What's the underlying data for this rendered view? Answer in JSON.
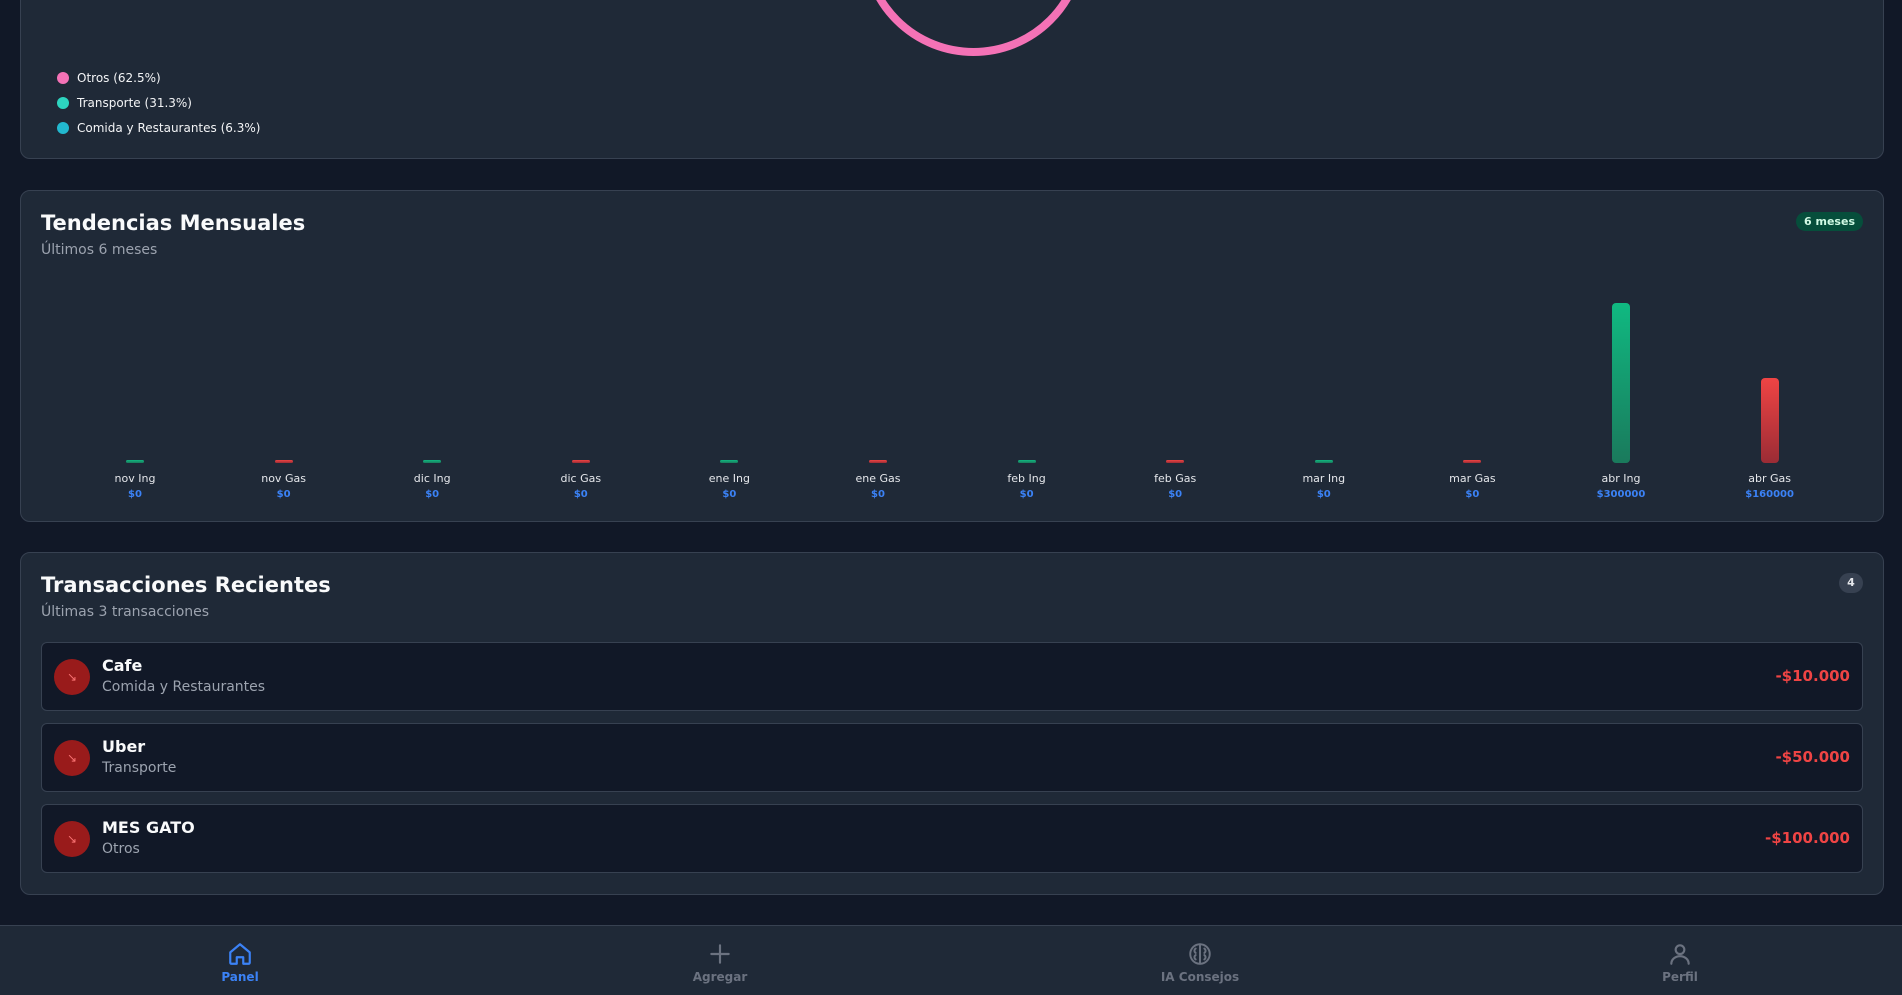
{
  "breakdown": {
    "legend": [
      {
        "label": "Otros (62.5%)",
        "color": "#f472b6"
      },
      {
        "label": "Transporte (31.3%)",
        "color": "#2dd4bf"
      },
      {
        "label": "Comida y Restaurantes (6.3%)",
        "color": "#22b8cf"
      }
    ]
  },
  "trends": {
    "title": "Tendencias Mensuales",
    "subtitle": "Últimos 6 meses",
    "badge": "6 meses",
    "bars": [
      {
        "label": "nov Ing",
        "value": "$0",
        "kind": "inc"
      },
      {
        "label": "nov Gas",
        "value": "$0",
        "kind": "exp"
      },
      {
        "label": "dic Ing",
        "value": "$0",
        "kind": "inc"
      },
      {
        "label": "dic Gas",
        "value": "$0",
        "kind": "exp"
      },
      {
        "label": "ene Ing",
        "value": "$0",
        "kind": "inc"
      },
      {
        "label": "ene Gas",
        "value": "$0",
        "kind": "exp"
      },
      {
        "label": "feb Ing",
        "value": "$0",
        "kind": "inc"
      },
      {
        "label": "feb Gas",
        "value": "$0",
        "kind": "exp"
      },
      {
        "label": "mar Ing",
        "value": "$0",
        "kind": "inc"
      },
      {
        "label": "mar Gas",
        "value": "$0",
        "kind": "exp"
      },
      {
        "label": "abr Ing",
        "value": "$300000",
        "kind": "inc"
      },
      {
        "label": "abr Gas",
        "value": "$160000",
        "kind": "exp"
      }
    ]
  },
  "chart_data": {
    "type": "bar",
    "categories": [
      "nov Ing",
      "nov Gas",
      "dic Ing",
      "dic Gas",
      "ene Ing",
      "ene Gas",
      "feb Ing",
      "feb Gas",
      "mar Ing",
      "mar Gas",
      "abr Ing",
      "abr Gas"
    ],
    "values": [
      0,
      0,
      0,
      0,
      0,
      0,
      0,
      0,
      0,
      0,
      300000,
      160000
    ],
    "title": "Tendencias Mensuales",
    "xlabel": "",
    "ylabel": "",
    "ylim": [
      0,
      300000
    ]
  },
  "transactions": {
    "title": "Transacciones Recientes",
    "subtitle": "Últimas 3 transacciones",
    "count": "4",
    "items": [
      {
        "title": "Cafe",
        "category": "Comida y Restaurantes",
        "amount": "-$10.000"
      },
      {
        "title": "Uber",
        "category": "Transporte",
        "amount": "-$50.000"
      },
      {
        "title": "MES GATO",
        "category": "Otros",
        "amount": "-$100.000"
      }
    ]
  },
  "nav": {
    "items": [
      {
        "label": "Panel",
        "icon": "home-icon",
        "active": true
      },
      {
        "label": "Agregar",
        "icon": "plus-icon",
        "active": false
      },
      {
        "label": "IA Consejos",
        "icon": "brain-icon",
        "active": false
      },
      {
        "label": "Perfil",
        "icon": "user-icon",
        "active": false
      }
    ]
  }
}
